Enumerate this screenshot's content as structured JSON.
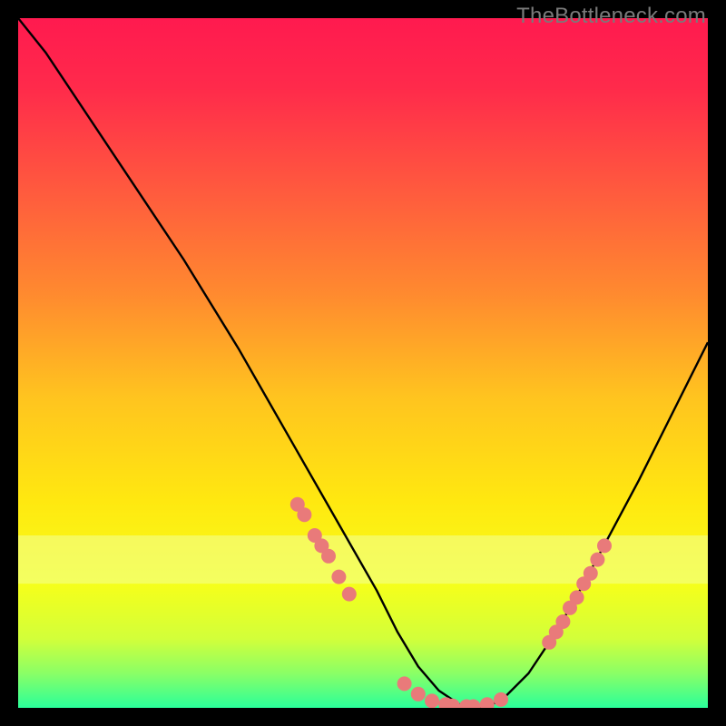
{
  "watermark": "TheBottleneck.com",
  "chart_data": {
    "type": "line",
    "title": "",
    "xlabel": "",
    "ylabel": "",
    "xlim": [
      0,
      100
    ],
    "ylim": [
      0,
      100
    ],
    "background_gradient": {
      "stops": [
        {
          "offset": 0.0,
          "color": "#ff1a4f"
        },
        {
          "offset": 0.1,
          "color": "#ff2a4b"
        },
        {
          "offset": 0.25,
          "color": "#ff5a3e"
        },
        {
          "offset": 0.4,
          "color": "#ff8a2f"
        },
        {
          "offset": 0.55,
          "color": "#ffc41f"
        },
        {
          "offset": 0.7,
          "color": "#ffe810"
        },
        {
          "offset": 0.82,
          "color": "#f6ff1a"
        },
        {
          "offset": 0.9,
          "color": "#d2ff3a"
        },
        {
          "offset": 0.95,
          "color": "#8aff66"
        },
        {
          "offset": 1.0,
          "color": "#2aff9a"
        }
      ],
      "highlight_band": {
        "y_start": 75,
        "y_end": 82,
        "color": "#f2ff99"
      }
    },
    "series": [
      {
        "name": "bottleneck-curve",
        "color": "#000000",
        "x": [
          0,
          4,
          8,
          12,
          16,
          20,
          24,
          28,
          32,
          36,
          40,
          44,
          48,
          52,
          55,
          58,
          61,
          64,
          67,
          70,
          74,
          78,
          82,
          86,
          90,
          94,
          98,
          100
        ],
        "y": [
          100,
          95,
          89,
          83,
          77,
          71,
          65,
          58.5,
          52,
          45,
          38,
          31,
          24,
          17,
          11,
          6,
          2.5,
          0.5,
          0,
          1,
          5,
          11,
          18,
          25.5,
          33,
          41,
          49,
          53
        ]
      }
    ],
    "markers": {
      "name": "highlight-dots",
      "color": "#e97a7a",
      "radius": 8,
      "points": [
        {
          "x": 40.5,
          "y": 29.5
        },
        {
          "x": 41.5,
          "y": 28.0
        },
        {
          "x": 43.0,
          "y": 25.0
        },
        {
          "x": 44.0,
          "y": 23.5
        },
        {
          "x": 45.0,
          "y": 22.0
        },
        {
          "x": 46.5,
          "y": 19.0
        },
        {
          "x": 48.0,
          "y": 16.5
        },
        {
          "x": 56.0,
          "y": 3.5
        },
        {
          "x": 58.0,
          "y": 2.0
        },
        {
          "x": 60.0,
          "y": 1.0
        },
        {
          "x": 62.0,
          "y": 0.5
        },
        {
          "x": 63.0,
          "y": 0.3
        },
        {
          "x": 65.0,
          "y": 0.2
        },
        {
          "x": 66.0,
          "y": 0.2
        },
        {
          "x": 68.0,
          "y": 0.5
        },
        {
          "x": 70.0,
          "y": 1.2
        },
        {
          "x": 77.0,
          "y": 9.5
        },
        {
          "x": 78.0,
          "y": 11.0
        },
        {
          "x": 79.0,
          "y": 12.5
        },
        {
          "x": 80.0,
          "y": 14.5
        },
        {
          "x": 81.0,
          "y": 16.0
        },
        {
          "x": 82.0,
          "y": 18.0
        },
        {
          "x": 83.0,
          "y": 19.5
        },
        {
          "x": 84.0,
          "y": 21.5
        },
        {
          "x": 85.0,
          "y": 23.5
        }
      ]
    }
  }
}
